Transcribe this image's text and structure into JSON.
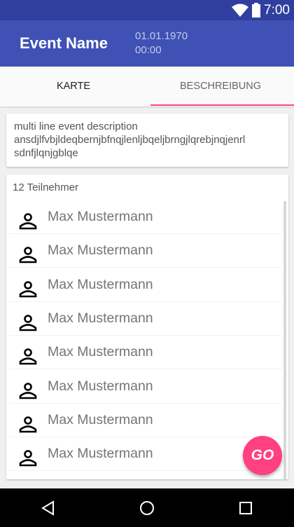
{
  "status_bar": {
    "time": "7:00",
    "icons": [
      "wifi-icon",
      "battery-icon"
    ]
  },
  "toolbar": {
    "title": "Event Name",
    "date": "01.01.1970",
    "time": "00:00"
  },
  "tabs": [
    {
      "label": "KARTE",
      "selected": false
    },
    {
      "label": "BESCHREIBUNG",
      "selected": true
    }
  ],
  "description": {
    "lines": [
      "multi line event description",
      "ansdjlfvbjldeqbernjbfnqjlenljbqeljbrngjlqrebjnqjenrl",
      "sdnfjlqnjgblqe"
    ]
  },
  "participants": {
    "count_label": "12 Teilnehmer",
    "items": [
      "Max Mustermann",
      "Max Mustermann",
      "Max Mustermann",
      "Max Mustermann",
      "Max Mustermann",
      "Max Mustermann",
      "Max Mustermann",
      "Max Mustermann"
    ]
  },
  "fab": {
    "label": "GO",
    "color": "#FF4081"
  },
  "colors": {
    "primary": "#3F51B5",
    "primary_dark": "#303F9F",
    "accent": "#FF4081"
  }
}
